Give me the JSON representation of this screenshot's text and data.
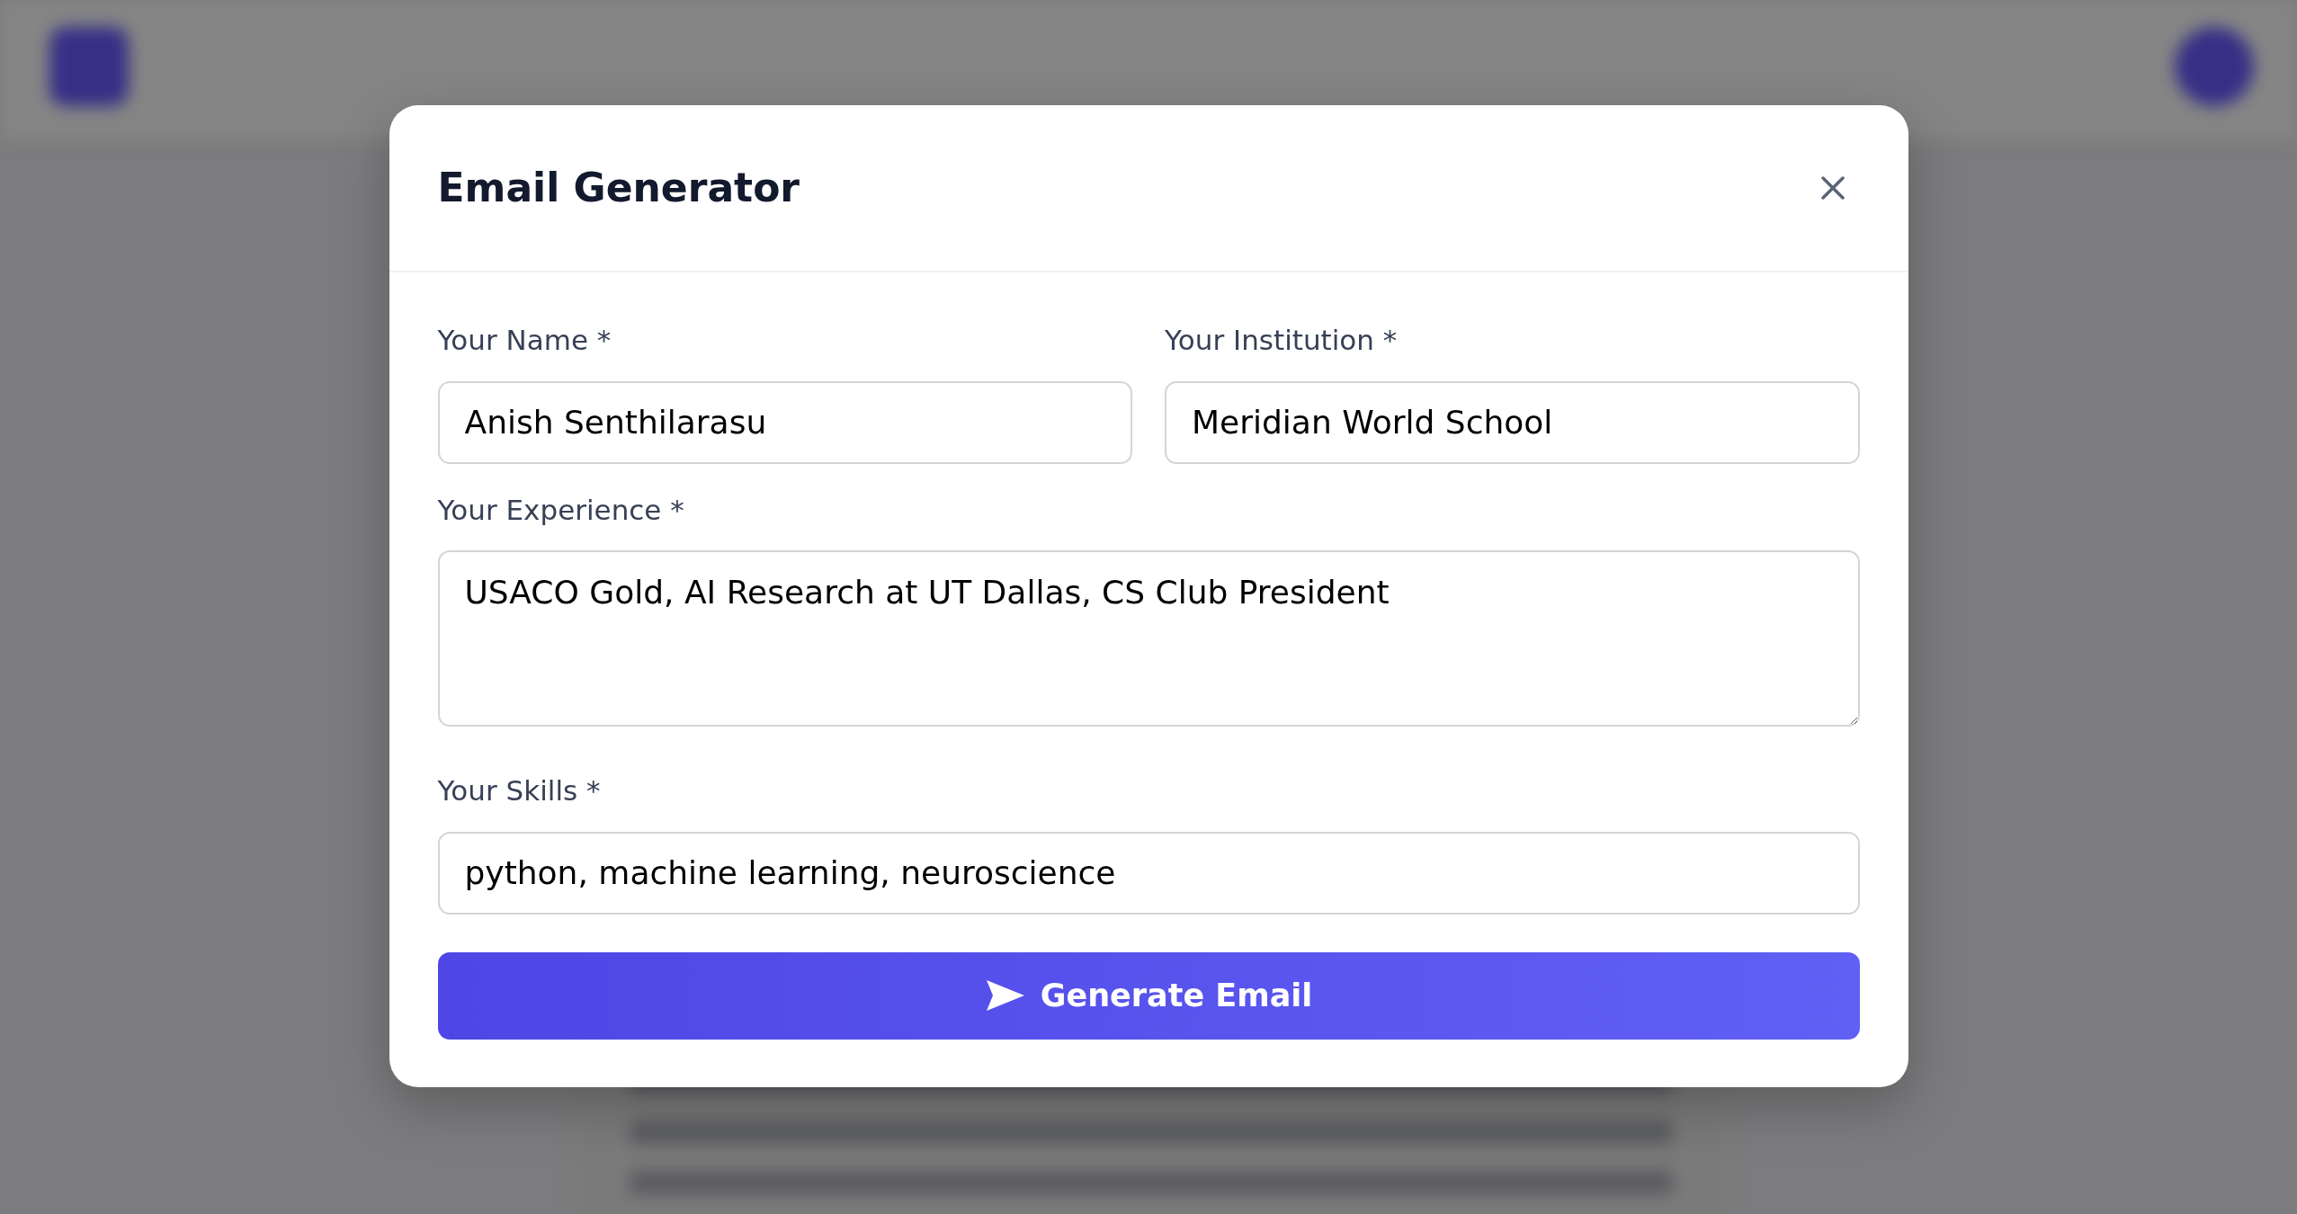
{
  "dialog": {
    "title": "Email Generator",
    "rows": [
      [
        {
          "kind": "input",
          "label": "Your Name *",
          "value": "Anish Senthilarasu"
        },
        {
          "kind": "input",
          "label": "Your Institution *",
          "value": "Meridian World School"
        }
      ],
      [
        {
          "kind": "textarea",
          "label": "Your Experience *",
          "value": "USACO Gold, AI Research at UT Dallas, CS Club President"
        }
      ],
      [
        {
          "kind": "input",
          "label": "Your Skills *",
          "value": "python, machine learning, neuroscience"
        }
      ]
    ],
    "submit": {
      "label": "Generate Email"
    }
  }
}
